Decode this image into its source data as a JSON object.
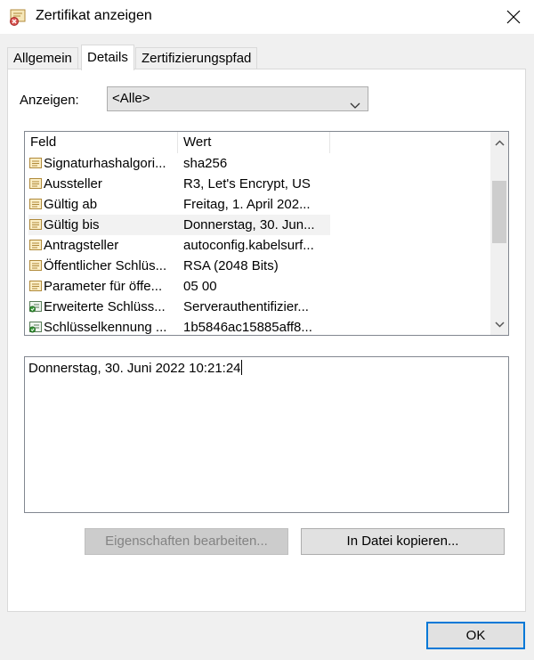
{
  "window": {
    "title": "Zertifikat anzeigen",
    "icon": "certificate-icon",
    "close_icon": "close-icon"
  },
  "tabs": [
    {
      "label": "Allgemein",
      "active": false
    },
    {
      "label": "Details",
      "active": true
    },
    {
      "label": "Zertifizierungspfad",
      "active": false
    }
  ],
  "details": {
    "show_label": "Anzeigen:",
    "show_selected": "<Alle>",
    "columns": [
      "Feld",
      "Wert"
    ],
    "rows": [
      {
        "field": "Signaturhashalgori...",
        "value": "sha256",
        "icon": "certificate-field-icon"
      },
      {
        "field": "Aussteller",
        "value": "R3, Let's Encrypt, US",
        "icon": "certificate-field-icon"
      },
      {
        "field": "Gültig ab",
        "value": "Freitag, 1. April 202...",
        "icon": "certificate-field-icon"
      },
      {
        "field": "Gültig bis",
        "value": "Donnerstag, 30. Jun...",
        "icon": "certificate-field-icon",
        "selected": true
      },
      {
        "field": "Antragsteller",
        "value": "autoconfig.kabelsurf...",
        "icon": "certificate-field-icon"
      },
      {
        "field": "Öffentlicher Schlüs...",
        "value": "RSA (2048 Bits)",
        "icon": "certificate-field-icon"
      },
      {
        "field": "Parameter für öffe...",
        "value": "05 00",
        "icon": "certificate-field-icon"
      },
      {
        "field": "Erweiterte Schlüss...",
        "value": "Serverauthentifizier...",
        "icon": "certificate-extension-icon"
      },
      {
        "field": "Schlüsselkennung ...",
        "value": "1b5846ac15885aff8...",
        "icon": "certificate-extension-icon"
      }
    ],
    "detail_text": "Donnerstag, 30. Juni 2022 10:21:24"
  },
  "buttons": {
    "edit_properties": "Eigenschaften bearbeiten...",
    "copy_to_file": "In Datei kopieren...",
    "ok": "OK"
  },
  "colors": {
    "accent": "#0078d7",
    "selected_row": "#f2f2f2",
    "disabled_text": "#838383"
  }
}
